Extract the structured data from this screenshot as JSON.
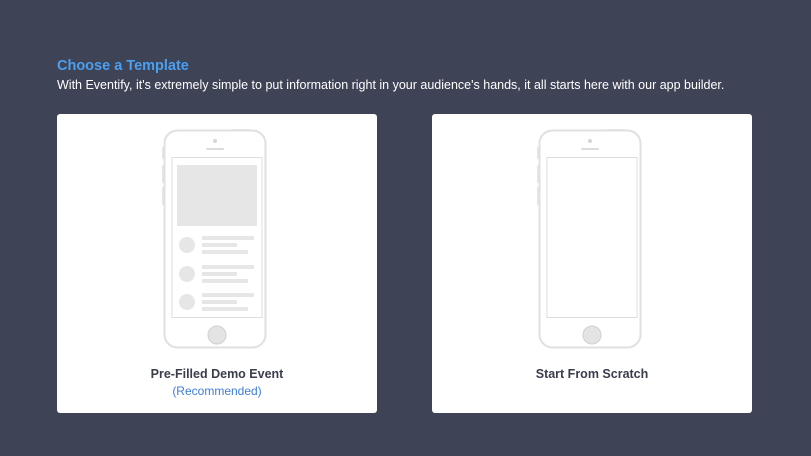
{
  "header": {
    "title": "Choose a Template",
    "description": "With Eventify, it's extremely simple to put information right in your audience's hands, it all starts here with our app builder."
  },
  "templates": [
    {
      "label": "Pre-Filled Demo Event",
      "sublabel": "(Recommended)",
      "icon": "phone-demo-icon"
    },
    {
      "label": "Start From Scratch",
      "sublabel": "",
      "icon": "phone-blank-icon"
    }
  ],
  "colors": {
    "background": "#3f4356",
    "accent": "#4a9ff0",
    "recommended": "#3d7dd8",
    "card": "#ffffff"
  }
}
